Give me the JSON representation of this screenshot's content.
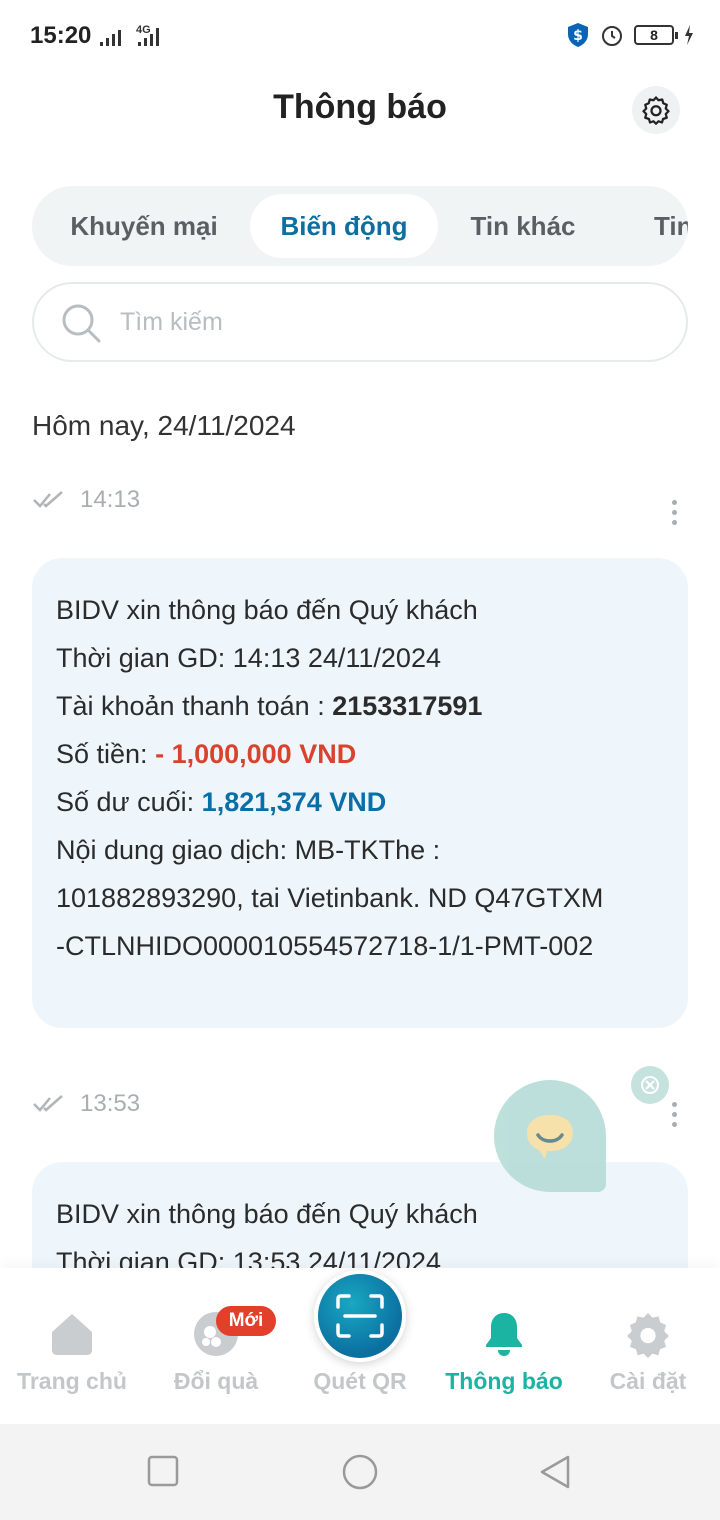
{
  "status_bar": {
    "time": "15:20",
    "network": "4G",
    "battery": "8"
  },
  "header": {
    "title": "Thông báo"
  },
  "tabs": [
    {
      "label": "Khuyến mại",
      "active": false
    },
    {
      "label": "Biến động",
      "active": true
    },
    {
      "label": "Tin khác",
      "active": false
    },
    {
      "label": "Tin",
      "active": false
    }
  ],
  "search": {
    "placeholder": "Tìm kiếm",
    "value": ""
  },
  "section": {
    "date_label": "Hôm nay, 24/11/2024"
  },
  "messages": [
    {
      "time": "14:13",
      "greeting": "BIDV xin thông báo đến Quý khách",
      "tx_time_label": "Thời gian GD:",
      "tx_time": "14:13 24/11/2024",
      "account_label": "Tài khoản thanh toán :",
      "account": "2153317591",
      "amount_label": "Số tiền:",
      "amount": "- 1,000,000 VND",
      "balance_label": "Số dư cuối:",
      "balance": "1,821,374 VND",
      "content_line1": "Nội dung giao dịch: MB-TKThe :",
      "content_line2": "101882893290, tai Vietinbank. ND Q47GTXM",
      "content_line3": "-CTLNHIDO000010554572718-1/1-PMT-002"
    },
    {
      "time": "13:53",
      "greeting": "BIDV xin thông báo đến Quý khách",
      "tx_time_label": "Thời gian GD:",
      "tx_time": "13:53 24/11/2024"
    }
  ],
  "bottom_nav": [
    {
      "label": "Trang chủ",
      "icon": "home-icon",
      "active": false
    },
    {
      "label": "Đổi quà",
      "icon": "gift-icon",
      "active": false,
      "badge": "Mới"
    },
    {
      "label": "Quét QR",
      "icon": "qr-scan-icon",
      "active": false
    },
    {
      "label": "Thông báo",
      "icon": "bell-icon",
      "active": true
    },
    {
      "label": "Cài đặt",
      "icon": "gear-icon",
      "active": false
    }
  ],
  "colors": {
    "accent_blue": "#0b6ea6",
    "negative_red": "#d8432e",
    "active_teal": "#1bb3a2",
    "card_bg": "#eff6fb"
  }
}
